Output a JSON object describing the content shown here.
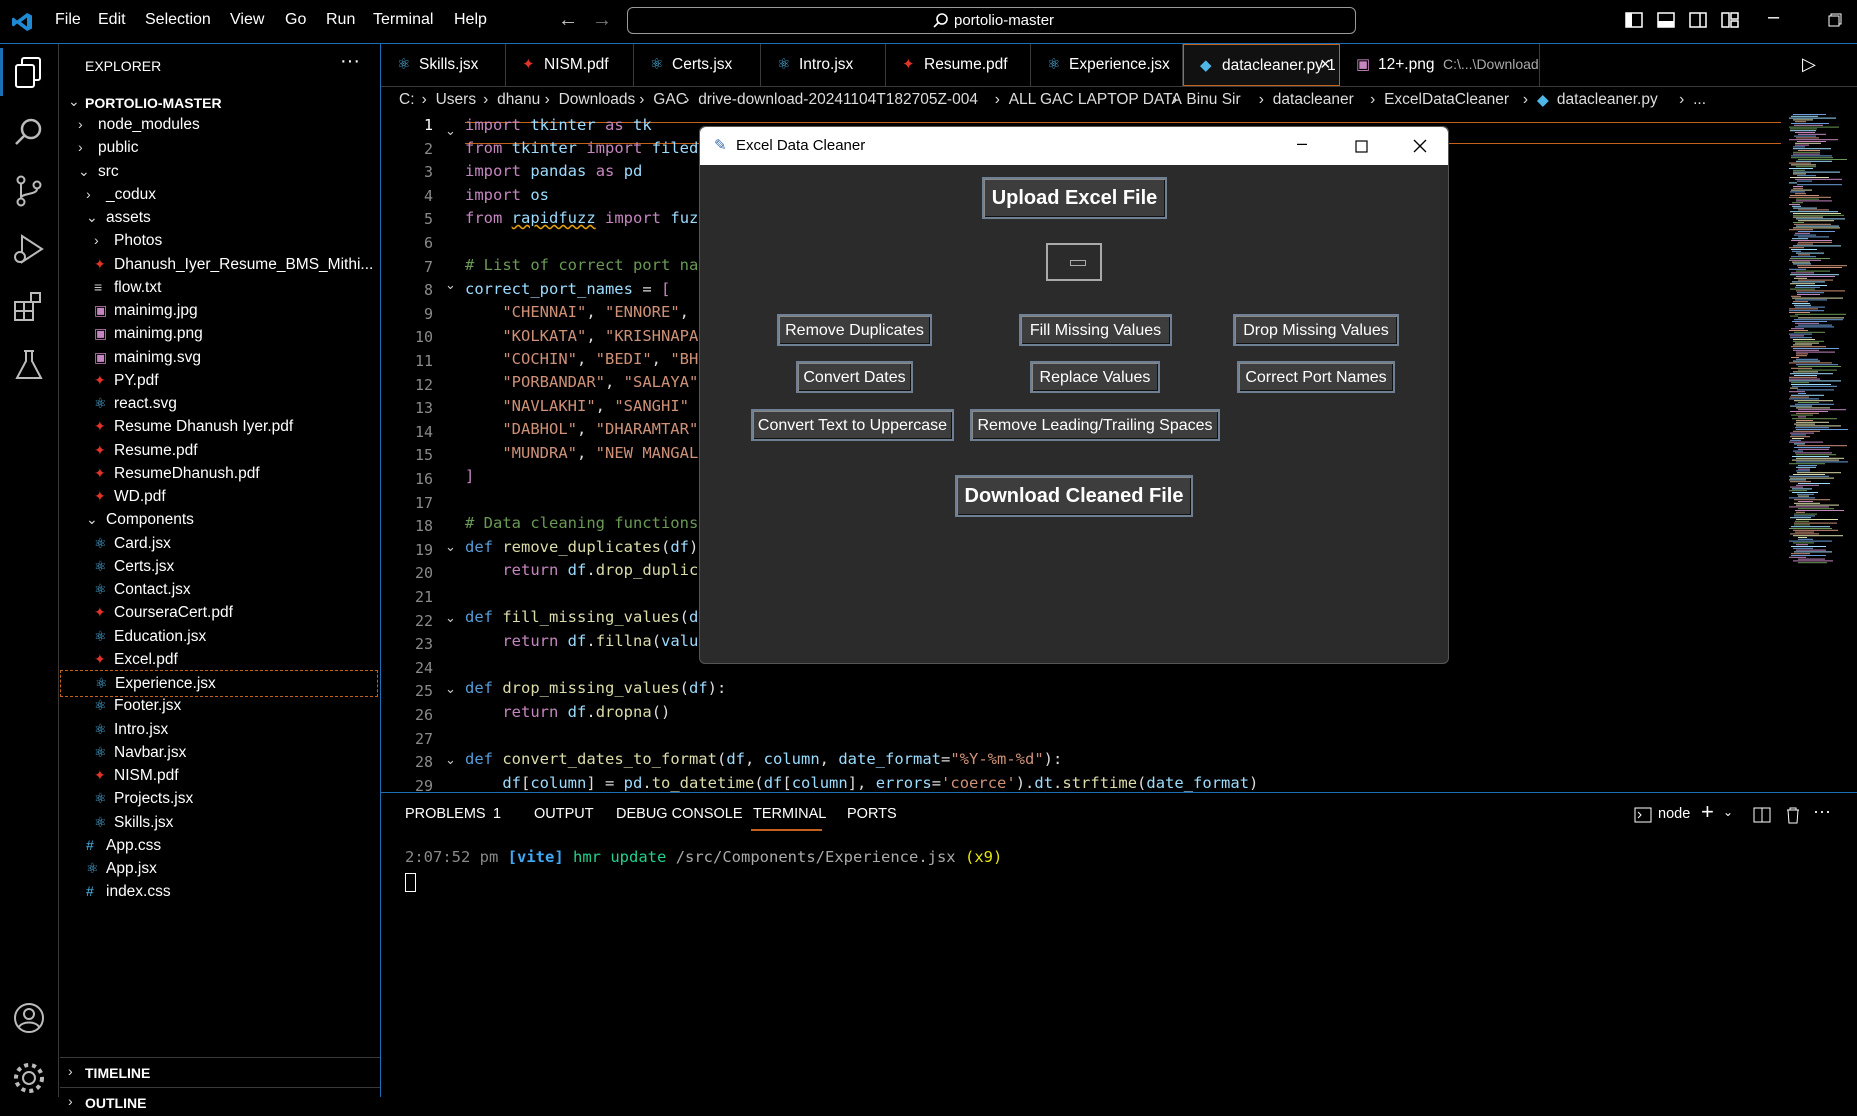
{
  "menubar": {
    "items": [
      "File",
      "Edit",
      "Selection",
      "View",
      "Go",
      "Run",
      "Terminal",
      "Help"
    ],
    "search_text": "portolio-master"
  },
  "explorer": {
    "title": "EXPLORER",
    "root": "PORTOLIO-MASTER",
    "items": [
      {
        "label": "node_modules"
      },
      {
        "label": "public"
      },
      {
        "label": "src"
      },
      {
        "label": "_codux"
      },
      {
        "label": "assets"
      },
      {
        "label": "Photos"
      },
      {
        "label": "Dhanush_Iyer_Resume_BMS_Mithi..."
      },
      {
        "label": "flow.txt"
      },
      {
        "label": "mainimg.jpg"
      },
      {
        "label": "mainimg.png"
      },
      {
        "label": "mainimg.svg"
      },
      {
        "label": "PY.pdf"
      },
      {
        "label": "react.svg"
      },
      {
        "label": "Resume Dhanush Iyer.pdf"
      },
      {
        "label": "Resume.pdf"
      },
      {
        "label": "ResumeDhanush.pdf"
      },
      {
        "label": "WD.pdf"
      },
      {
        "label": "Components"
      },
      {
        "label": "Card.jsx"
      },
      {
        "label": "Certs.jsx"
      },
      {
        "label": "Contact.jsx"
      },
      {
        "label": "CourseraCert.pdf"
      },
      {
        "label": "Education.jsx"
      },
      {
        "label": "Excel.pdf"
      },
      {
        "label": "Experience.jsx"
      },
      {
        "label": "Footer.jsx"
      },
      {
        "label": "Intro.jsx"
      },
      {
        "label": "Navbar.jsx"
      },
      {
        "label": "NISM.pdf"
      },
      {
        "label": "Projects.jsx"
      },
      {
        "label": "Skills.jsx"
      },
      {
        "label": "App.css"
      },
      {
        "label": "App.jsx"
      },
      {
        "label": "index.css"
      }
    ],
    "timeline": "TIMELINE",
    "outline": "OUTLINE"
  },
  "tabs": [
    {
      "label": "Skills.jsx"
    },
    {
      "label": "NISM.pdf"
    },
    {
      "label": "Certs.jsx"
    },
    {
      "label": "Intro.jsx"
    },
    {
      "label": "Resume.pdf"
    },
    {
      "label": "Experience.jsx"
    },
    {
      "label": "datacleaner.py 1"
    },
    {
      "label": "12+.png",
      "desc": "C:\\...\\Downloads"
    }
  ],
  "breadcrumb": [
    "C:",
    "Users",
    "dhanu",
    "Downloads",
    "GAC",
    "drive-download-20241104T182705Z-004",
    "ALL GAC LAPTOP DATA",
    "Binu Sir",
    "datacleaner",
    "ExcelDataCleaner",
    "datacleaner.py",
    "..."
  ],
  "code": {
    "line_numbers": [
      "1",
      "2",
      "3",
      "4",
      "5",
      "6",
      "7",
      "8",
      "9",
      "10",
      "11",
      "12",
      "13",
      "14",
      "15",
      "16",
      "17",
      "18",
      "19",
      "20",
      "21",
      "22",
      "23",
      "24",
      "25",
      "26",
      "27",
      "28",
      "29"
    ]
  },
  "dialog": {
    "title": "Excel Data Cleaner",
    "upload": "Upload Excel File",
    "buttons": {
      "remove_duplicates": "Remove Duplicates",
      "fill_missing": "Fill Missing Values",
      "drop_missing": "Drop Missing Values",
      "convert_dates": "Convert Dates",
      "replace_values": "Replace Values",
      "correct_ports": "Correct Port Names",
      "uppercase": "Convert Text to Uppercase",
      "trim_spaces": "Remove Leading/Trailing Spaces"
    },
    "download": "Download Cleaned File"
  },
  "panel": {
    "tabs": {
      "problems": "PROBLEMS",
      "problems_count": "1",
      "output": "OUTPUT",
      "debug": "DEBUG CONSOLE",
      "terminal": "TERMINAL",
      "ports": "PORTS"
    },
    "terminal_name": "node",
    "log": {
      "time": "2:07:52 pm",
      "tag": "[vite]",
      "msg": "hmr update",
      "path": "/src/Components/Experience.jsx",
      "count": "(x9)"
    }
  },
  "colors": {
    "accent": "#1a6fb5",
    "active_file_border": "#c4621b"
  }
}
